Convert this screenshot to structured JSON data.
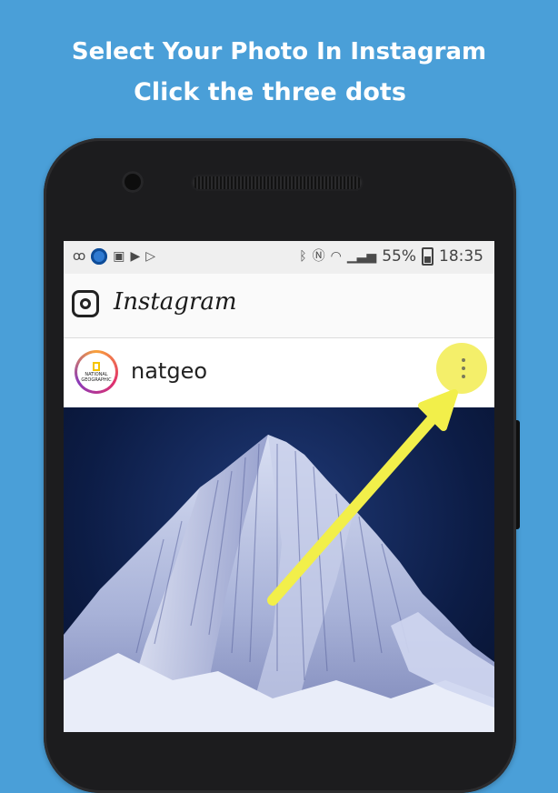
{
  "headline": {
    "line1": "Select Your Photo In Instagram",
    "line2": "Click the three dots"
  },
  "status_bar": {
    "left_icons": [
      "voicemail-icon",
      "facebook-icon",
      "image-icon",
      "play-store-icon",
      "play-icon"
    ],
    "right_icons": [
      "bluetooth-icon",
      "nfc-icon",
      "wifi-icon",
      "signal-icon"
    ],
    "battery": "55%",
    "time": "18:35"
  },
  "app_bar": {
    "logo_text": "Instagram",
    "camera_icon": "camera-icon"
  },
  "post": {
    "username": "natgeo",
    "avatar_text": "NATIONAL GEOGRAPHIC",
    "more_icon": "three-dots-vertical-icon",
    "highlight_color": "#f4ef6a",
    "image_subject": "mountain-photo"
  },
  "colors": {
    "background": "#4a9fd8",
    "arrow": "#f2ef4a"
  }
}
